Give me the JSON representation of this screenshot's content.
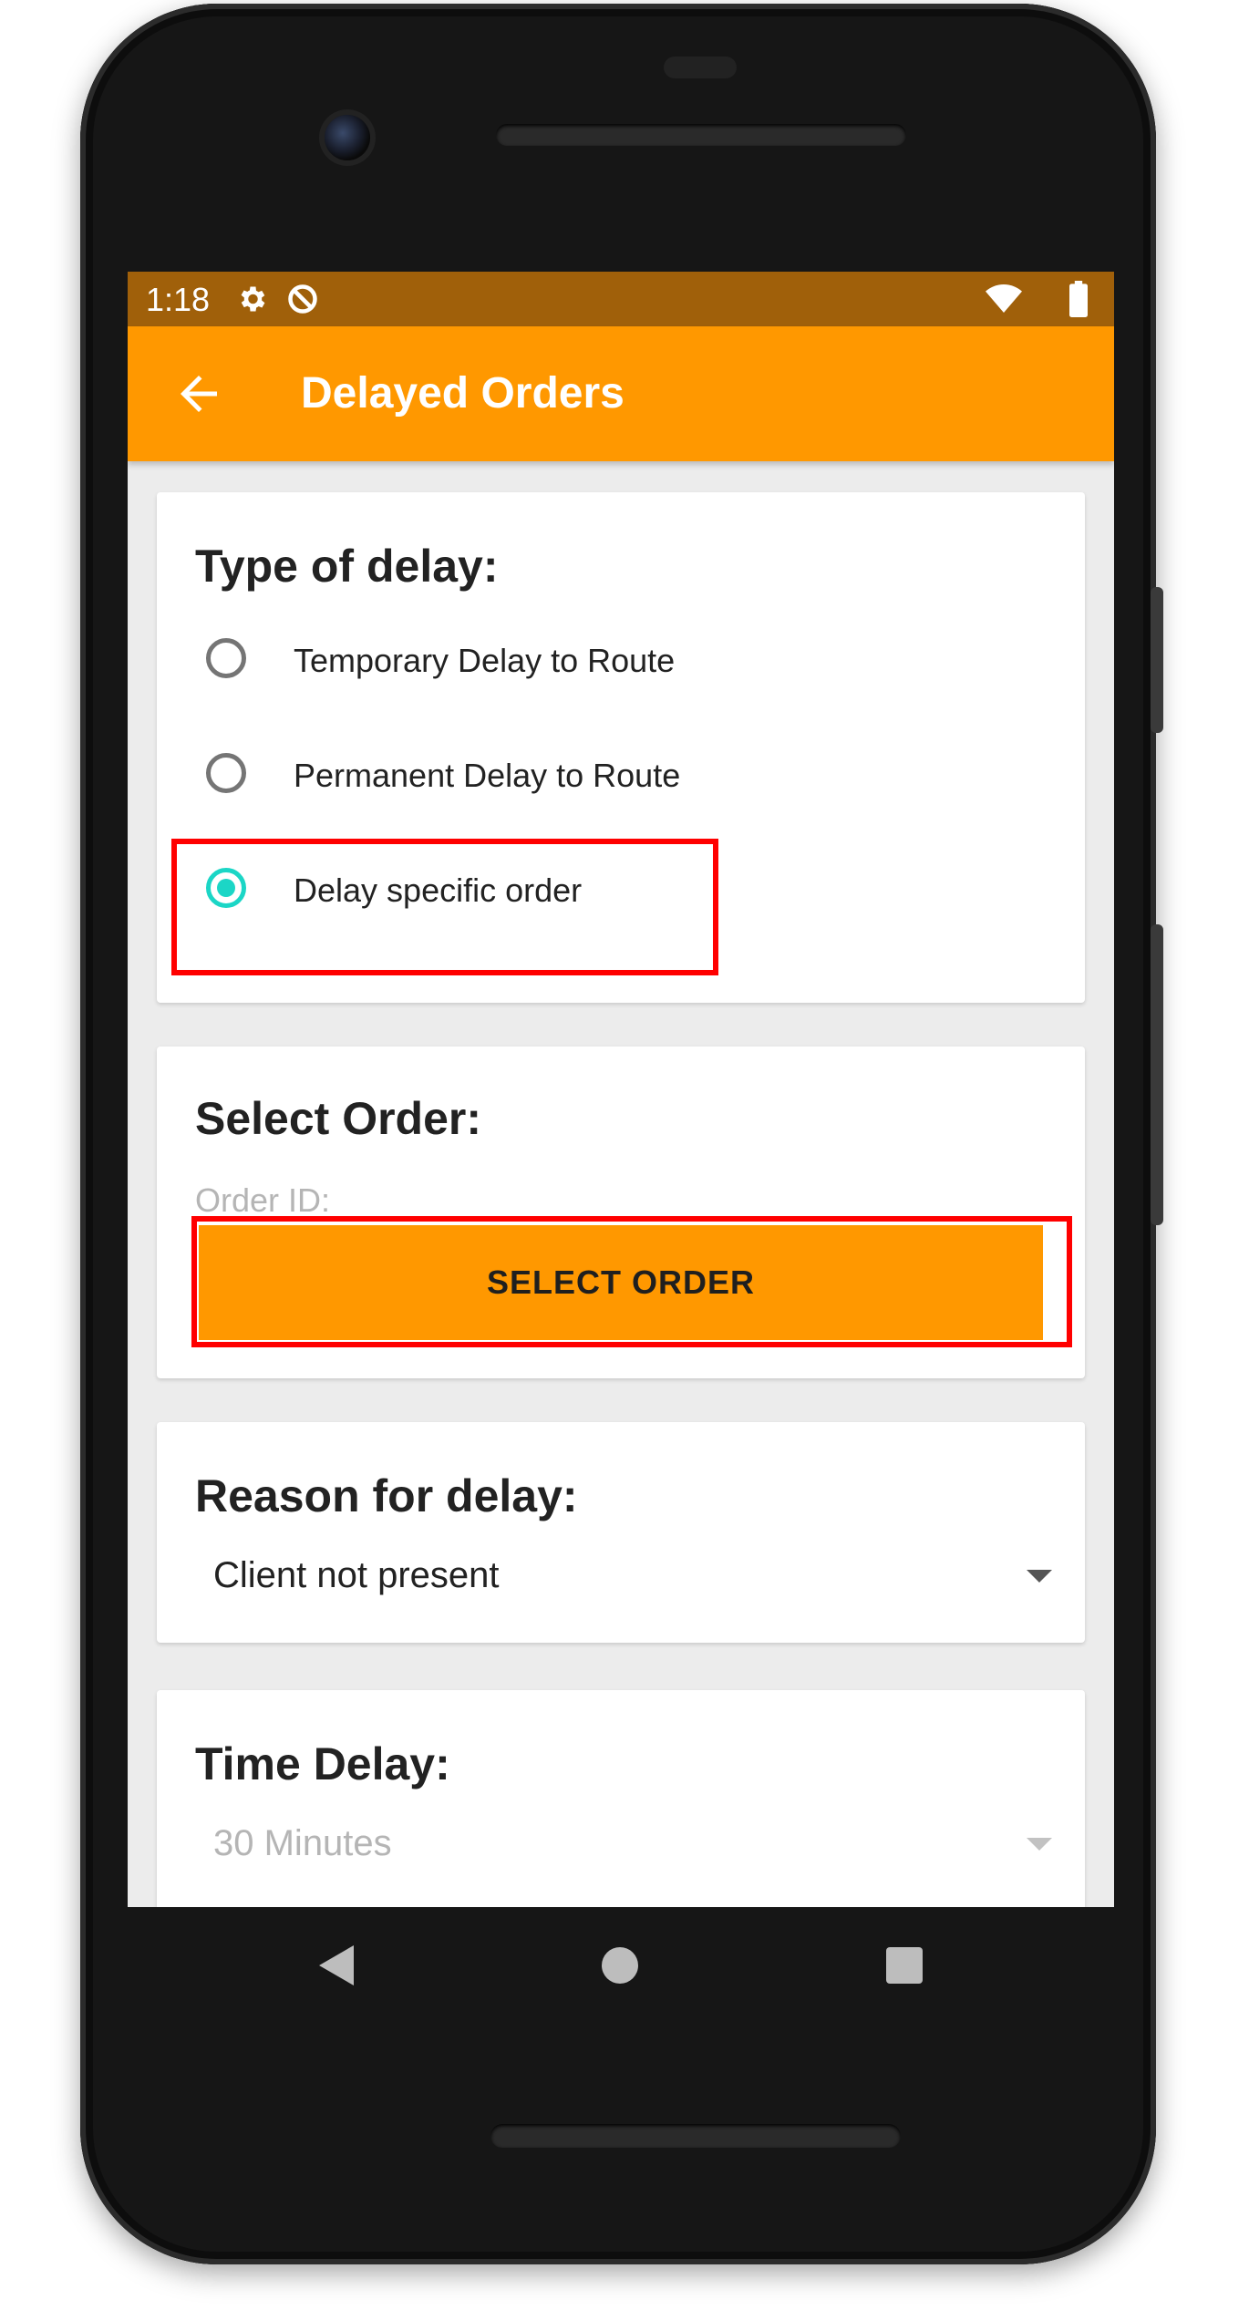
{
  "status_bar": {
    "time": "1:18",
    "icons": [
      "gear-icon",
      "do-not-disturb-icon",
      "wifi-icon",
      "battery-icon"
    ]
  },
  "app_bar": {
    "title": "Delayed Orders",
    "back_icon": "arrow-back-icon",
    "background": "#ff9800"
  },
  "delay_type": {
    "title": "Type of delay:",
    "options": [
      {
        "label": "Temporary Delay to Route",
        "checked": false
      },
      {
        "label": "Permanent Delay to Route",
        "checked": false
      },
      {
        "label": "Delay specific order",
        "checked": true
      }
    ]
  },
  "select_order": {
    "title": "Select Order:",
    "order_id_label": "Order ID:",
    "button_label": "SELECT ORDER"
  },
  "reason": {
    "title": "Reason for delay:",
    "selected": "Client not present"
  },
  "time_delay": {
    "title": "Time Delay:",
    "selected": "30 Minutes"
  },
  "colors": {
    "accent": "#ff9800",
    "status_bar": "#a0600a",
    "radio_checked": "#1bd6c6",
    "highlight": "#ff0000"
  },
  "nav_bar": {
    "icons": [
      "nav-back-icon",
      "nav-home-icon",
      "nav-recents-icon"
    ]
  }
}
